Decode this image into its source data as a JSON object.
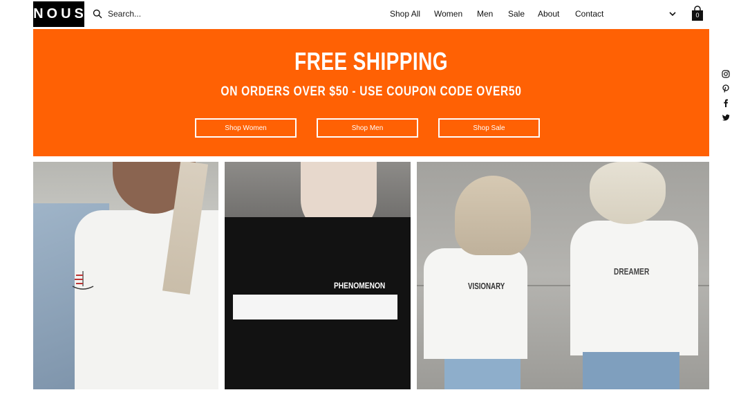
{
  "header": {
    "logo": "NOUS",
    "search_placeholder": "Search...",
    "nav": [
      "Shop All",
      "Women",
      "Men",
      "Sale",
      "About",
      "Contact"
    ],
    "cart_count": "0"
  },
  "banner": {
    "background": "#ff6104",
    "title": "FREE SHIPPING",
    "subtitle": "ON ORDERS OVER $50 - USE COUPON CODE OVER50",
    "buttons": [
      "Shop Women",
      "Shop Men",
      "Shop Sale"
    ]
  },
  "social": [
    "instagram-icon",
    "pinterest-icon",
    "facebook-icon",
    "twitter-icon"
  ],
  "photos": {
    "men_shirt": "PHENOMENON",
    "women_shirt": "VISIONARY",
    "man_shirt": "DREAMER"
  }
}
